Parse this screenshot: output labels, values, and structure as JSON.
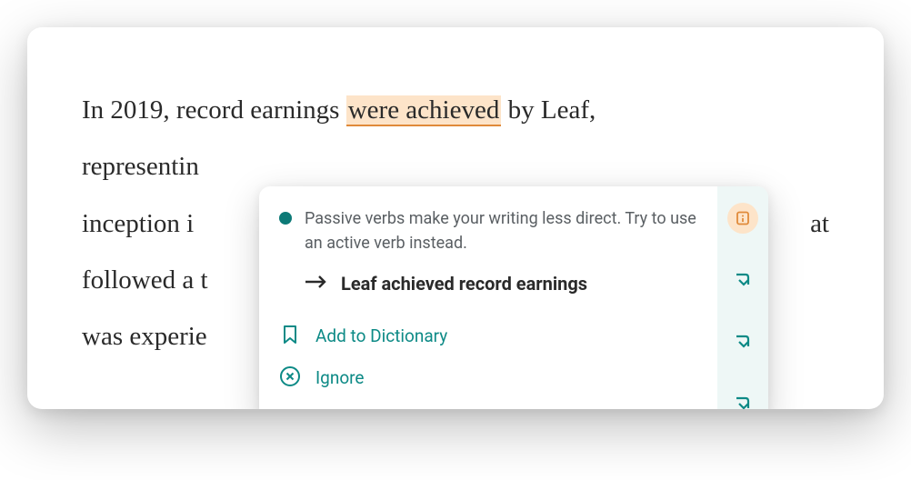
{
  "document": {
    "line_prefix": "In 2019, record earnings ",
    "highlighted": "were achieved",
    "line_suffix": " by Leaf,",
    "rest": "representin\ninception i\nfollowed a t\nwas experie",
    "rest_suffix_frag": "at"
  },
  "popup": {
    "explanation": "Passive verbs make your writing less direct. Try to use an active verb instead.",
    "suggestion": "Leaf achieved record earnings",
    "add_to_dictionary": "Add to Dictionary",
    "ignore": "Ignore"
  }
}
